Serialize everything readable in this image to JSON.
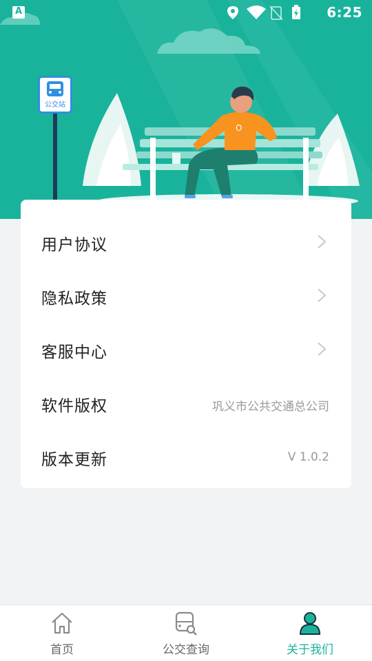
{
  "status_bar": {
    "time": "6:25"
  },
  "hero": {
    "bus_sign_text": "公交站"
  },
  "menu": {
    "items": [
      {
        "label": "用户协议",
        "value": "",
        "has_arrow": true
      },
      {
        "label": "隐私政策",
        "value": "",
        "has_arrow": true
      },
      {
        "label": "客服中心",
        "value": "",
        "has_arrow": true
      },
      {
        "label": "软件版权",
        "value": "巩义市公共交通总公司",
        "has_arrow": false
      },
      {
        "label": "版本更新",
        "value": "V 1.0.2",
        "has_arrow": false
      }
    ]
  },
  "tabbar": {
    "tabs": [
      {
        "label": "首页",
        "icon": "home-icon",
        "active": false
      },
      {
        "label": "公交查询",
        "icon": "bus-search-icon",
        "active": false
      },
      {
        "label": "关于我们",
        "icon": "person-icon",
        "active": true
      }
    ]
  },
  "colors": {
    "accent": "#19b39c",
    "background": "#f2f3f5"
  }
}
